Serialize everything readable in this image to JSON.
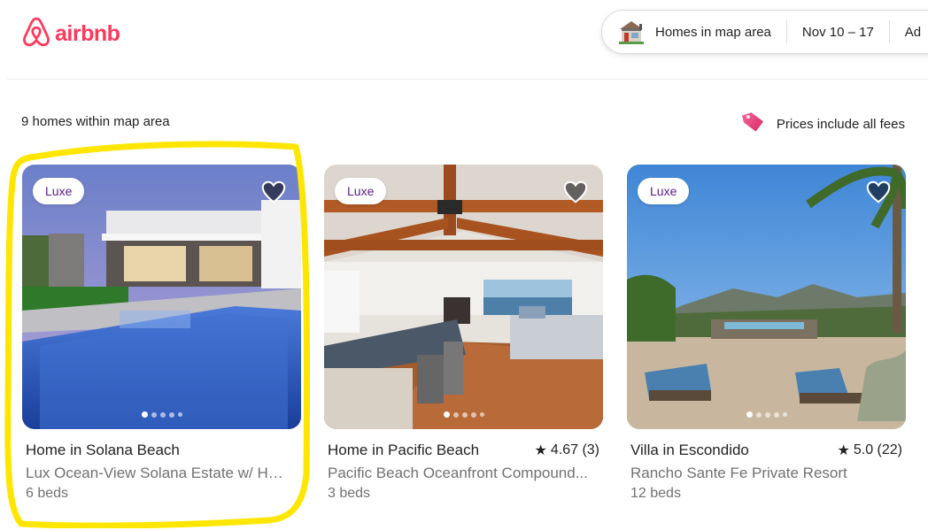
{
  "brand": {
    "name": "airbnb",
    "color": "#ff385c"
  },
  "search": {
    "location": "Homes in map area",
    "dates": "Nov 10 – 17",
    "guests": "Ad"
  },
  "results": {
    "count_text": "9 homes within map area",
    "fees_text": "Prices include all fees"
  },
  "listings": [
    {
      "badge": "Luxe",
      "title": "Home in Solana Beach",
      "rating": "",
      "subtitle": "Lux Ocean-View Solana Estate w/ Hot...",
      "beds": "6 beds",
      "highlighted": true
    },
    {
      "badge": "Luxe",
      "title": "Home in Pacific Beach",
      "rating": "4.67 (3)",
      "subtitle": "Pacific Beach Oceanfront Compound...",
      "beds": "3 beds",
      "highlighted": false
    },
    {
      "badge": "Luxe",
      "title": "Villa in Escondido",
      "rating": "5.0 (22)",
      "subtitle": "Rancho Sante Fe Private Resort",
      "beds": "12 beds",
      "highlighted": false
    }
  ],
  "icons": {
    "logo": "airbnb-logo-icon",
    "search_category": "house-icon",
    "fees": "price-tag-icon",
    "favorite": "heart-icon",
    "star": "star-icon"
  },
  "colors": {
    "highlight": "#ffe600",
    "badge_text": "#5b1a8a"
  }
}
